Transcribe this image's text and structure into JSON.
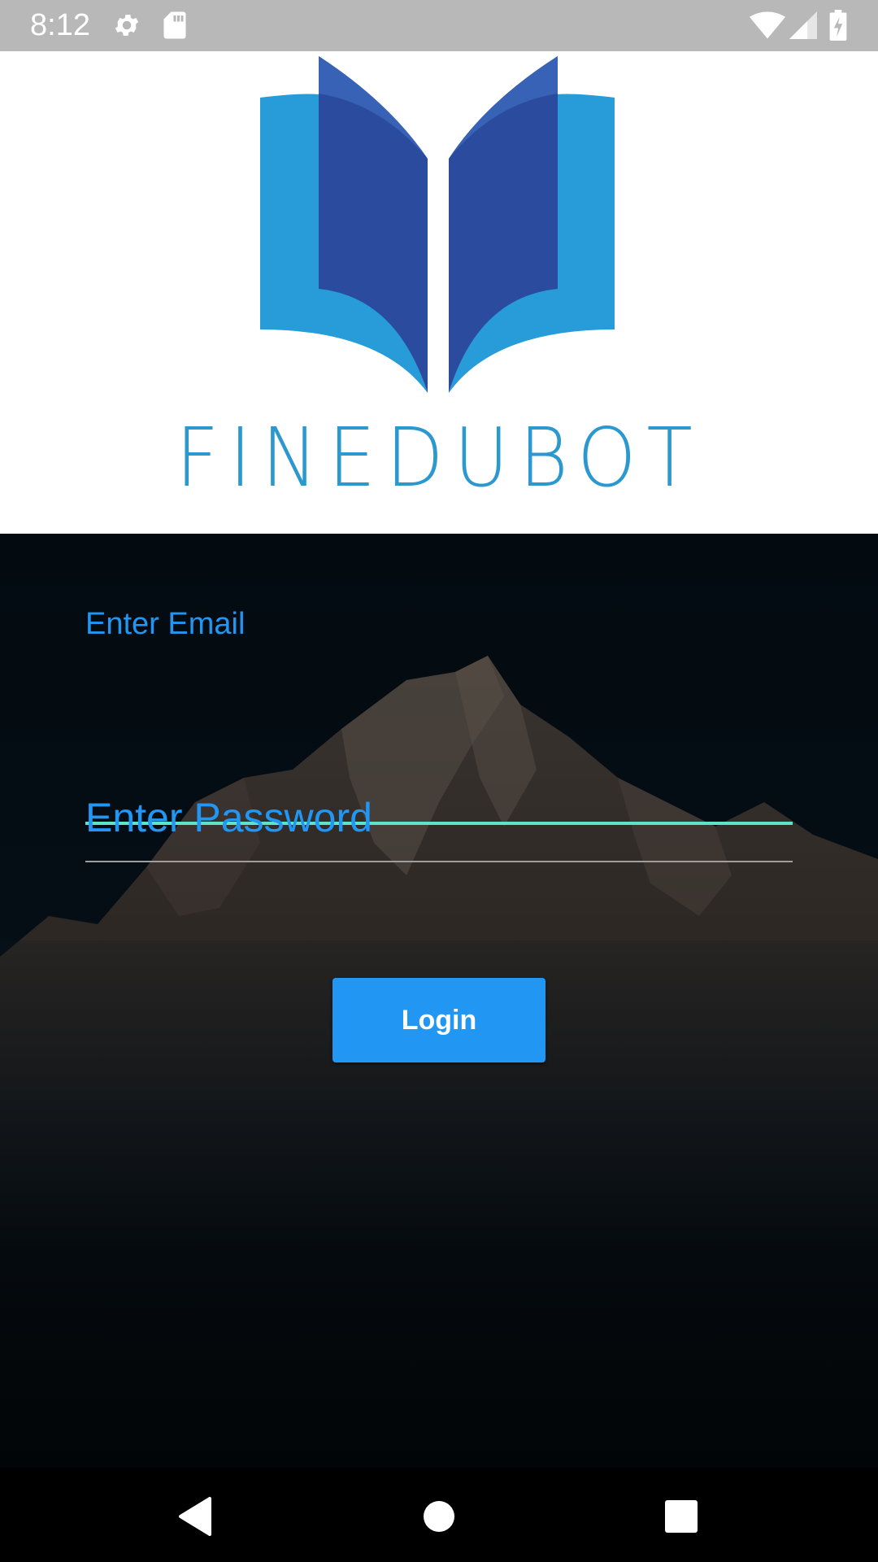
{
  "status_bar": {
    "time": "8:12",
    "icons": [
      "gear-icon",
      "sd-card-icon",
      "wifi-icon",
      "signal-icon",
      "battery-charging-icon"
    ]
  },
  "logo": {
    "text": "FINEDUBOT",
    "icon": "open-book-logo",
    "colors": {
      "outer": "#279cd8",
      "inner": "#2a4b9e",
      "text": "#2c98d0"
    }
  },
  "login_form": {
    "email_label": "Enter Email",
    "email_value": "",
    "password_label": "Enter Password",
    "password_value": "",
    "login_button": "Login"
  },
  "nav_bar": {
    "icons": [
      "back-icon",
      "home-icon",
      "recents-icon"
    ]
  },
  "colors": {
    "accent": "#2196f3",
    "focus_underline": "#5de4c7",
    "background": "#030c12"
  }
}
